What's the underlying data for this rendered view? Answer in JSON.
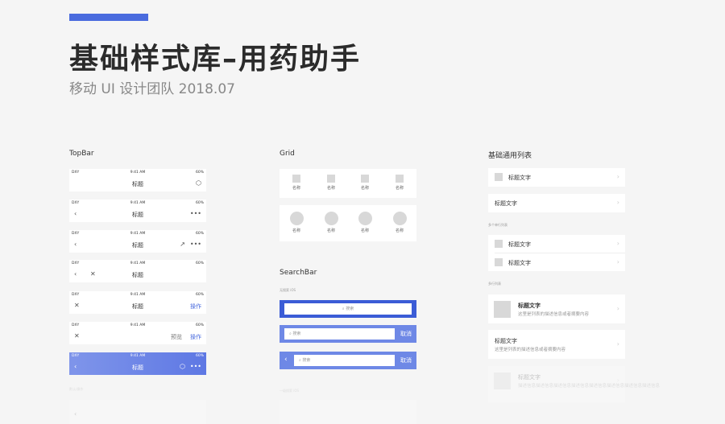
{
  "header": {
    "title": "基础样式库–用药助手",
    "subtitle": "移动 UI 设计团队 2018.07"
  },
  "columns": {
    "topbar": "TopBar",
    "grid": "Grid",
    "list": "基础通用列表",
    "searchbar": "SearchBar"
  },
  "status": {
    "carrier": "DXY",
    "time": "9:41 AM",
    "battery": "60%"
  },
  "topbar": {
    "title": "标题",
    "action": "操作",
    "preview": "预览",
    "footer_label": "默认/操作"
  },
  "grid": {
    "label": "名称"
  },
  "searchbar": {
    "label_ios": "无搜索 iOS",
    "placeholder": "搜索",
    "cancel": "取消",
    "footer_label": "一级搜索 iOS"
  },
  "list": {
    "item_title": "标题文字",
    "single_label": "多个单行列表",
    "multi_label": "多行列表",
    "desc": "这里是列表的描述信息或者摘要内容",
    "desc_long": "描述信息描述信息描述信息描述信息描述信息描述信息描述信息描述信息"
  },
  "icons": {
    "back": "chevron-left-icon",
    "close": "close-icon",
    "more": "more-icon",
    "share": "share-icon",
    "shield": "shield-icon",
    "search": "search-icon",
    "arrow": "chevron-right-icon"
  },
  "colors": {
    "accent": "#4a6bde",
    "search_dark": "#3b5cd6",
    "search_light": "#6e88e6"
  }
}
